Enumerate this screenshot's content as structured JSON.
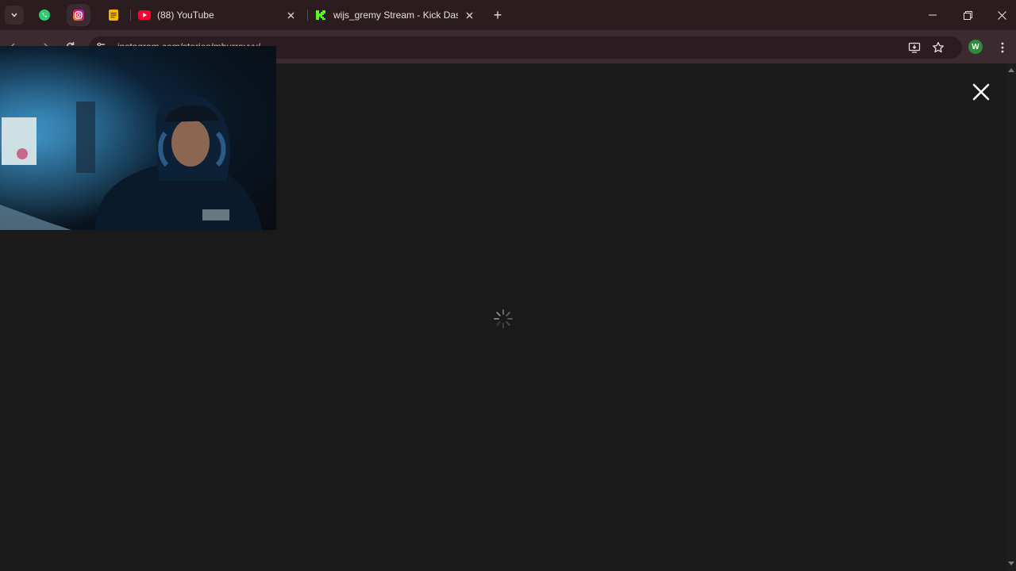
{
  "tabs": {
    "pinned": [
      {
        "name": "WhatsApp",
        "icon": "whatsapp-icon"
      },
      {
        "name": "Instagram",
        "icon": "instagram-icon",
        "active": true
      },
      {
        "name": "Notes",
        "icon": "notes-icon"
      }
    ],
    "items": [
      {
        "title": "(88) YouTube",
        "icon": "youtube-icon"
      },
      {
        "title": "wijs_gremy Stream - Kick Dashb",
        "icon": "kick-icon"
      }
    ],
    "new_tab_label": "+"
  },
  "address_bar": {
    "url": "instagram.com/stories/mhurrayyy/"
  },
  "profile": {
    "initial": "W",
    "color": "#2f8a3a"
  },
  "colors": {
    "tabstrip": "#2b1c20",
    "toolbar": "#3b2a2f",
    "content_bg": "#1a1a1a"
  }
}
